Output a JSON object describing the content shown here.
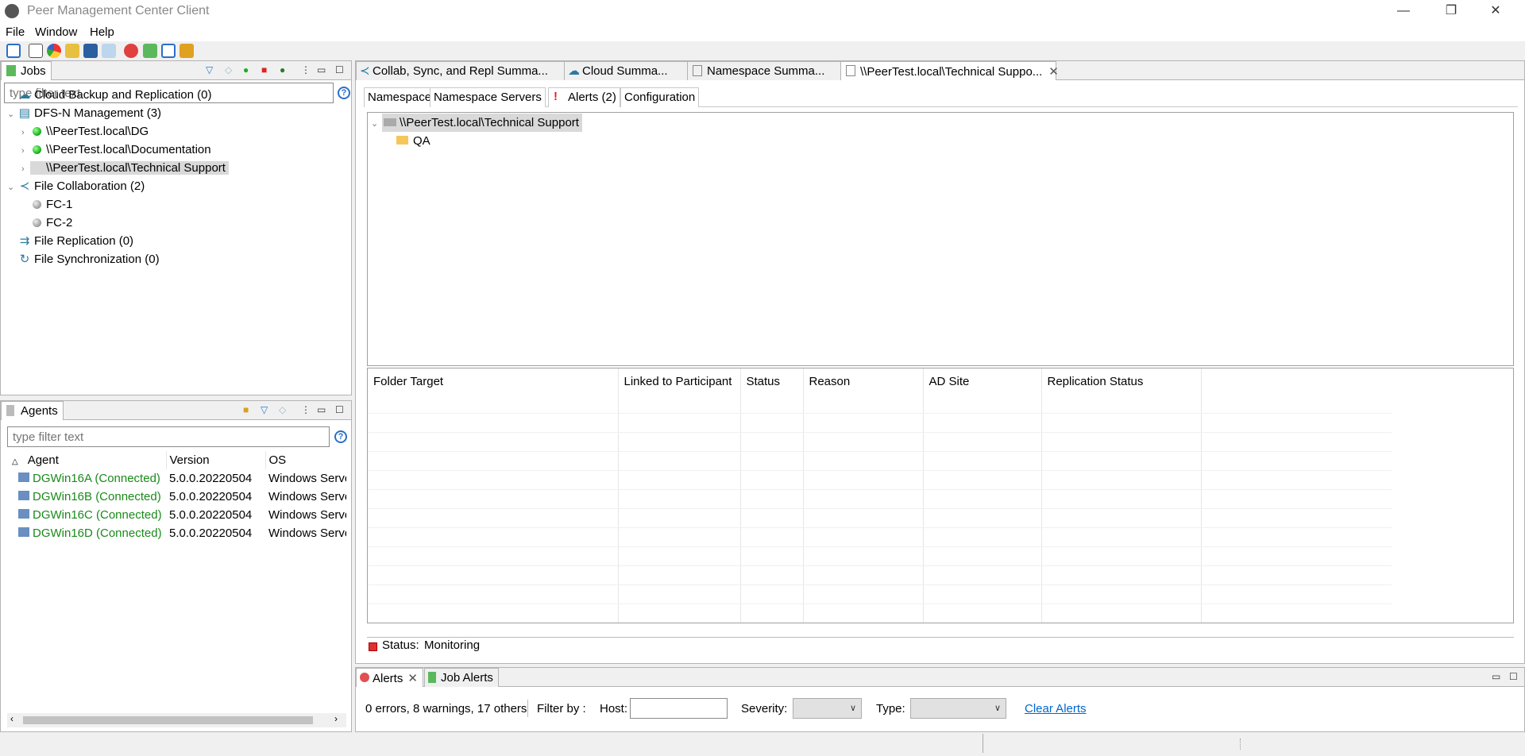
{
  "window": {
    "title": "Peer Management Center Client",
    "minimize": "—",
    "restore": "❐",
    "close": "✕"
  },
  "menu": [
    "File",
    "Window",
    "Help"
  ],
  "toolbar_icons": [
    "new-job-icon",
    "properties-icon",
    "chart-icon",
    "agent-icon",
    "schedule-icon",
    "tag-icon",
    "alert-icon",
    "jobs-icon",
    "clipboard-icon",
    "sync-icon"
  ],
  "jobs": {
    "tab": "Jobs",
    "filter_placeholder": "type filter text",
    "help": "?",
    "tree": [
      {
        "label": "Cloud Backup and Replication (0)",
        "level": 0,
        "icon": "cloud-icon"
      },
      {
        "label": "DFS-N Management (3)",
        "level": 0,
        "icon": "dfs-icon",
        "expanded": true
      },
      {
        "label": "\\\\PeerTest.local\\DG",
        "level": 1,
        "status": "green"
      },
      {
        "label": "\\\\PeerTest.local\\Documentation",
        "level": 1,
        "status": "green"
      },
      {
        "label": "\\\\PeerTest.local\\Technical Support",
        "level": 1,
        "status": "green",
        "selected": true
      },
      {
        "label": "File Collaboration (2)",
        "level": 0,
        "icon": "collab-icon",
        "expanded": true
      },
      {
        "label": "FC-1",
        "level": 1,
        "status": "gray"
      },
      {
        "label": "FC-2",
        "level": 1,
        "status": "gray"
      },
      {
        "label": "File Replication (0)",
        "level": 0,
        "icon": "replication-icon"
      },
      {
        "label": "File Synchronization (0)",
        "level": 0,
        "icon": "sync-icon"
      }
    ]
  },
  "agents": {
    "tab": "Agents",
    "filter_placeholder": "type filter text",
    "help": "?",
    "columns": [
      "Agent",
      "Version",
      "OS"
    ],
    "rows": [
      [
        "DGWin16A (Connected)",
        "5.0.0.20220504",
        "Windows Serve"
      ],
      [
        "DGWin16B (Connected)",
        "5.0.0.20220504",
        "Windows Serve"
      ],
      [
        "DGWin16C (Connected)",
        "5.0.0.20220504",
        "Windows Serve"
      ],
      [
        "DGWin16D (Connected)",
        "5.0.0.20220504",
        "Windows Serve"
      ]
    ]
  },
  "editor": {
    "tabs": [
      "Collab, Sync, and Repl Summa...",
      "Cloud Summa...",
      "Namespace Summa...",
      "\\\\PeerTest.local\\Technical Suppo..."
    ],
    "close": "✕",
    "subtabs": [
      "Namespace",
      "Namespace Servers",
      "Alerts (2)",
      "Configuration"
    ],
    "tree_root": "\\\\PeerTest.local\\Technical Support",
    "tree_child": "QA",
    "columns": [
      "Folder Target",
      "Linked to Participant",
      "Status",
      "Reason",
      "AD Site",
      "Replication Status"
    ],
    "status_label": "Status:",
    "status_value": "Monitoring"
  },
  "alerts": {
    "tabs": [
      "Alerts",
      "Job Alerts"
    ],
    "summary": "0 errors, 8 warnings, 17 others",
    "filter_by": "Filter by :",
    "host_label": "Host:",
    "host_value": "",
    "severity_label": "Severity:",
    "severity_value": "",
    "type_label": "Type:",
    "type_value": "",
    "clear": "Clear Alerts"
  },
  "colors": {
    "connected": "#1a8a1a",
    "link": "#0066cc",
    "selection": "#d9d9d9"
  }
}
